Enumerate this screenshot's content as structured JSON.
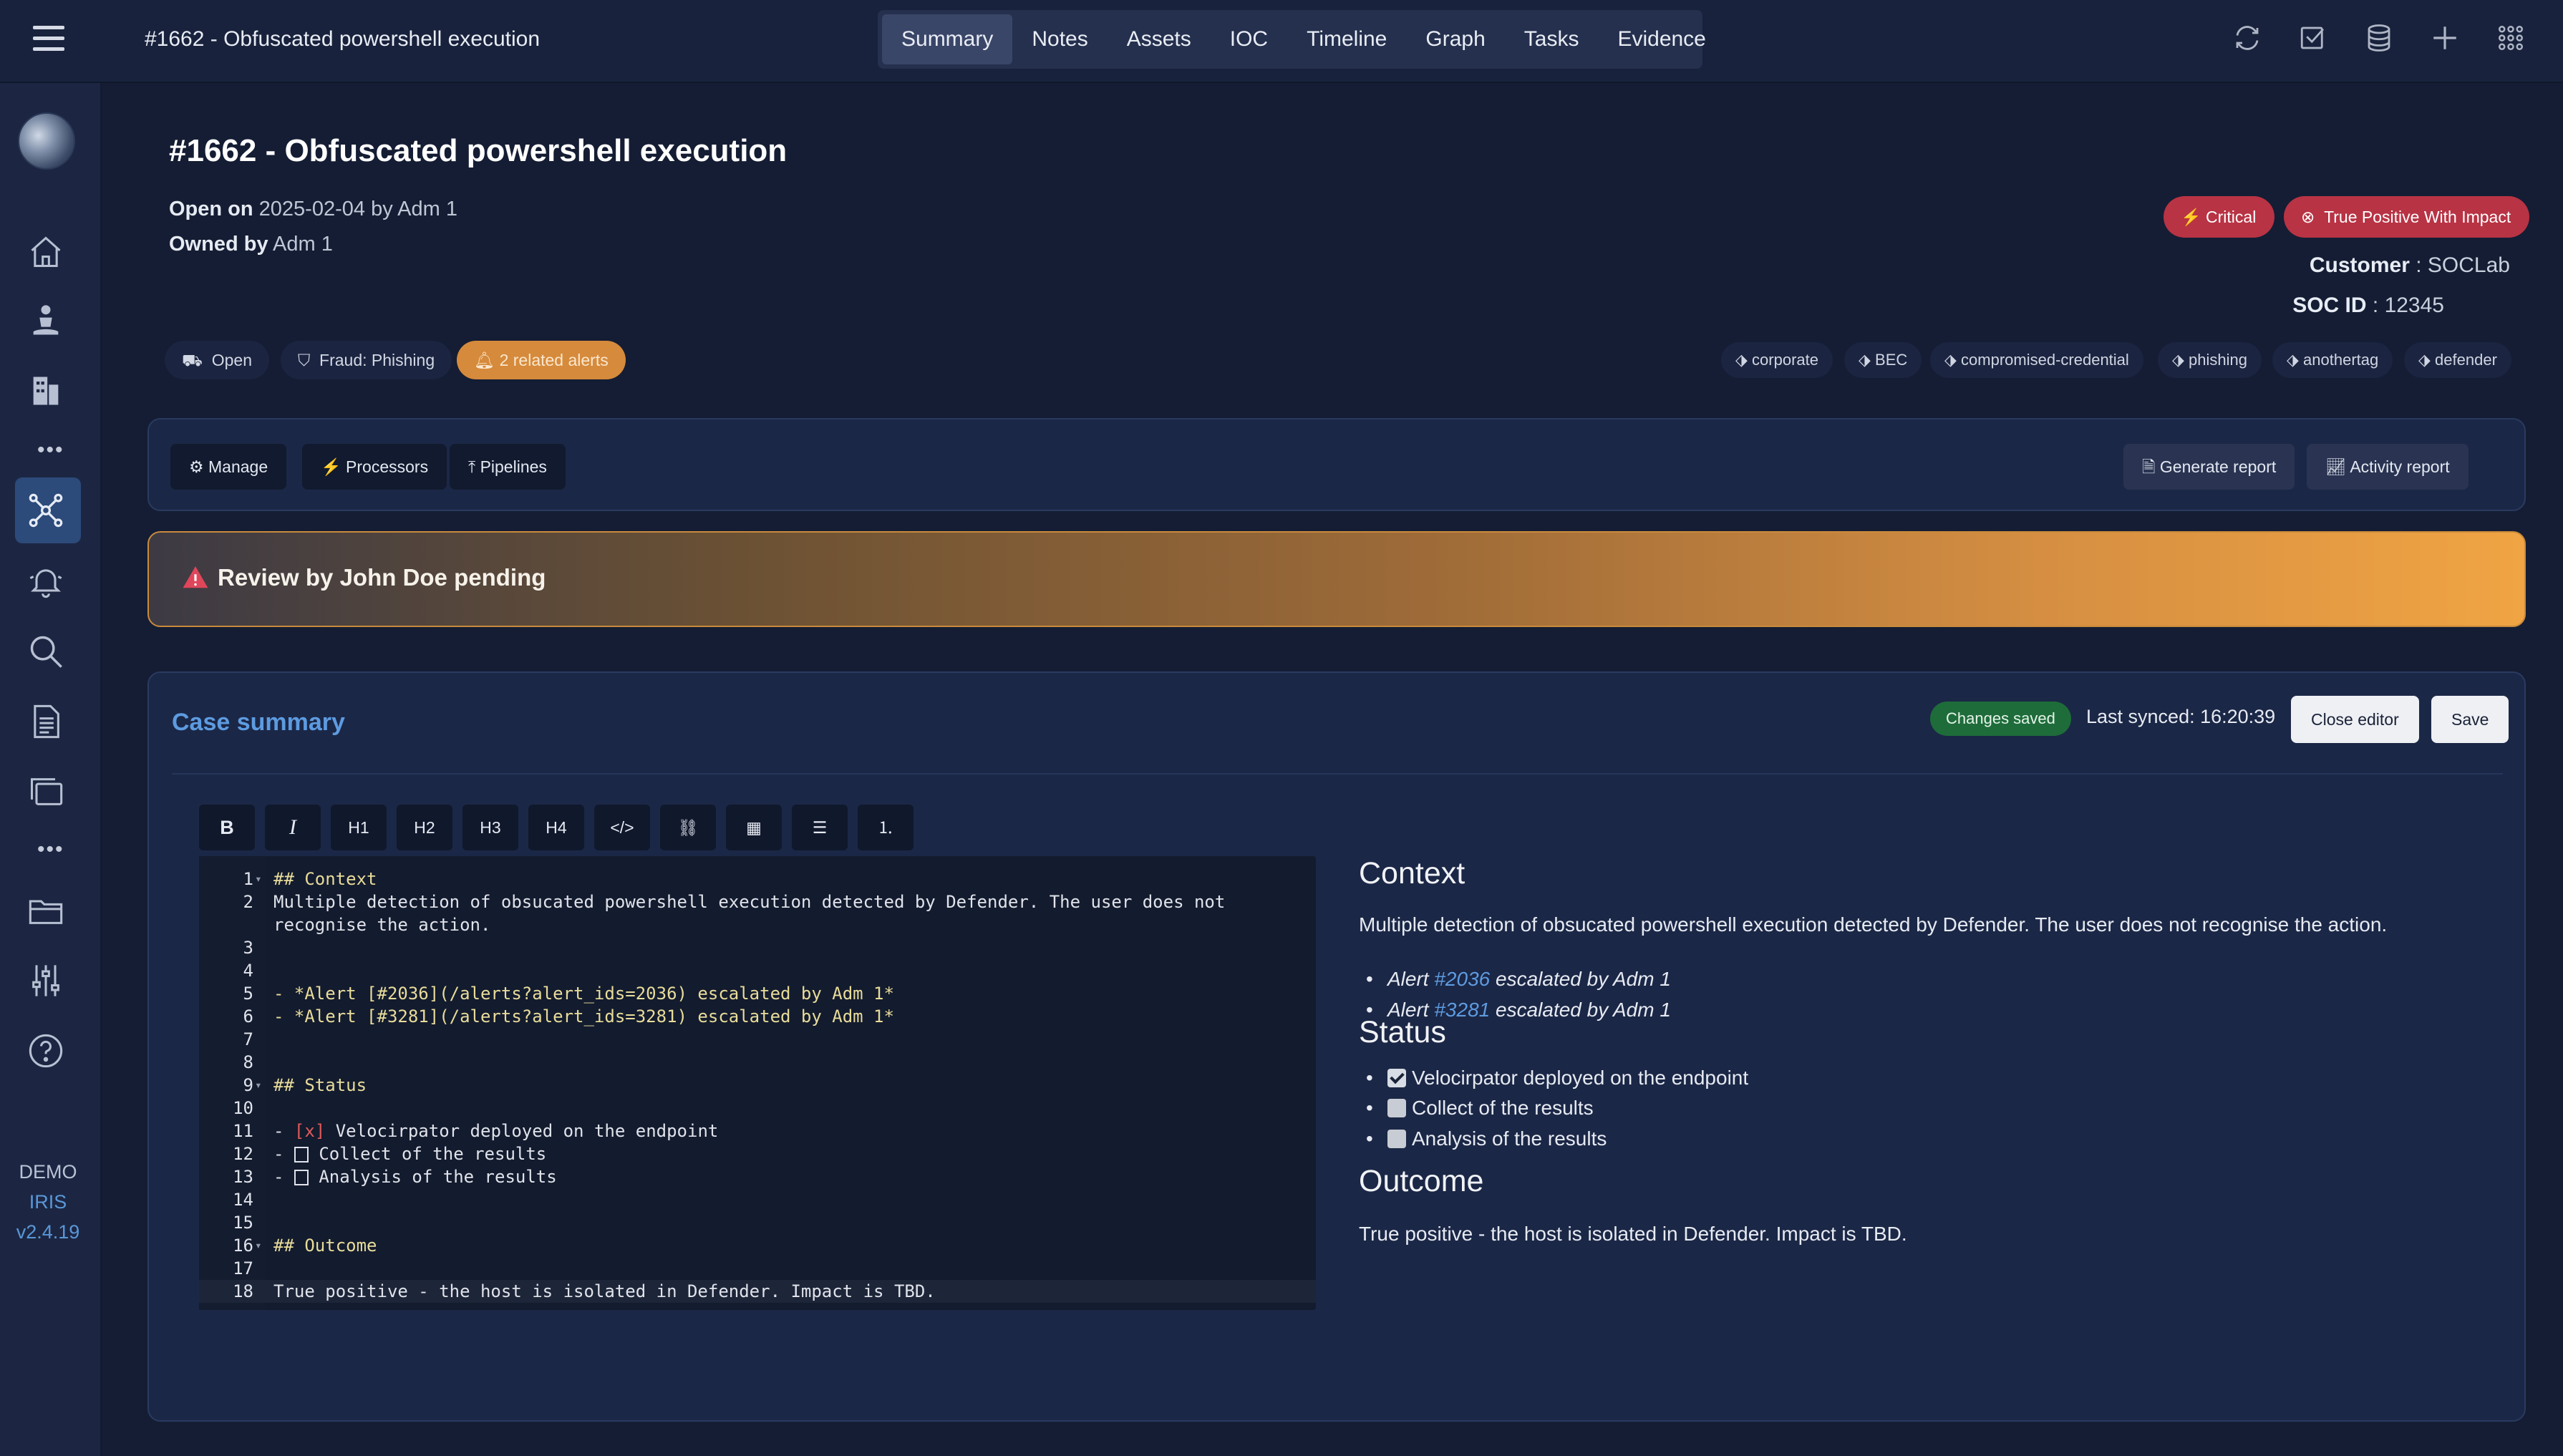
{
  "topbar": {
    "title": "#1662 - Obfuscated powershell execution",
    "tabs": [
      {
        "label": "Summary"
      },
      {
        "label": "Notes"
      },
      {
        "label": "Assets"
      },
      {
        "label": "IOC"
      },
      {
        "label": "Timeline"
      },
      {
        "label": "Graph"
      },
      {
        "label": "Tasks"
      },
      {
        "label": "Evidence"
      }
    ],
    "icons": [
      "refresh-icon",
      "check-square-icon",
      "database-icon",
      "plus-icon",
      "apps-grid-icon"
    ]
  },
  "sidebar": {
    "icons": [
      "home-icon",
      "user-icon",
      "building-icon",
      "cases-network-icon",
      "alerts-bell-icon",
      "search-icon",
      "reports-icon",
      "layers-icon",
      "folder-icon",
      "settings-sliders-icon",
      "help-icon"
    ],
    "demo_label": "DEMO",
    "iris_label": "IRIS",
    "version": "v2.4.19"
  },
  "case": {
    "title": "#1662 - Obfuscated powershell execution",
    "open_label": "Open on",
    "open_value": "2025-02-04 by Adm 1",
    "owned_label": "Owned by",
    "owned_value": "Adm 1",
    "severity": "Critical",
    "outcome": "True Positive With Impact",
    "customer_label": "Customer",
    "customer_value": "SOCLab",
    "soc_id_label": "SOC ID",
    "soc_id_value": "12345",
    "status_pill": "Open",
    "classification_pill": "Fraud: Phishing",
    "alerts_pill": "2 related alerts",
    "tags": [
      "corporate",
      "BEC",
      "compromised-credential",
      "phishing",
      "anothertag",
      "defender"
    ]
  },
  "actions": {
    "manage": "Manage",
    "processors": "Processors",
    "pipelines": "Pipelines",
    "generate_report": "Generate report",
    "activity_report": "Activity report"
  },
  "review": {
    "text": "Review by John Doe pending"
  },
  "summary": {
    "title": "Case summary",
    "saved_badge": "Changes saved",
    "last_synced": "Last synced: 16:20:39",
    "close_editor": "Close editor",
    "save": "Save",
    "toolbar": [
      "B",
      "I",
      "H1",
      "H2",
      "H3",
      "H4",
      "</>",
      "link",
      "table",
      "ul",
      "ol"
    ],
    "editor_lines": [
      {
        "n": "1",
        "text": "## Context"
      },
      {
        "n": "2",
        "text": "Multiple detection of obsucated powershell execution detected by Defender. The user does not"
      },
      {
        "n": "",
        "text": "recognise the action."
      },
      {
        "n": "3",
        "text": ""
      },
      {
        "n": "4",
        "text": ""
      },
      {
        "n": "5",
        "text": "- *Alert [#2036](/alerts?alert_ids=2036) escalated by Adm 1*"
      },
      {
        "n": "6",
        "text": "- *Alert [#3281](/alerts?alert_ids=3281) escalated by Adm 1*"
      },
      {
        "n": "7",
        "text": ""
      },
      {
        "n": "8",
        "text": ""
      },
      {
        "n": "9",
        "text": "## Status"
      },
      {
        "n": "10",
        "text": ""
      },
      {
        "n": "11",
        "text": "- [x] Velocirpator deployed on the endpoint"
      },
      {
        "n": "12",
        "text": "- [ ] Collect of the results"
      },
      {
        "n": "13",
        "text": "- [ ] Analysis of the results"
      },
      {
        "n": "14",
        "text": ""
      },
      {
        "n": "15",
        "text": ""
      },
      {
        "n": "16",
        "text": "## Outcome"
      },
      {
        "n": "17",
        "text": ""
      },
      {
        "n": "18",
        "text": "True positive - the host is isolated in Defender. Impact is TBD."
      }
    ],
    "preview": {
      "context_heading": "Context",
      "context_text": "Multiple detection of obsucated powershell execution detected by Defender. The user does not recognise the action.",
      "alert1_prefix": "Alert ",
      "alert1_link": "#2036",
      "alert1_suffix": " escalated by Adm 1",
      "alert2_prefix": "Alert ",
      "alert2_link": "#3281",
      "alert2_suffix": " escalated by Adm 1",
      "status_heading": "Status",
      "task1": "Velocirpator deployed on the endpoint",
      "task2": "Collect of the results",
      "task3": "Analysis of the results",
      "outcome_heading": "Outcome",
      "outcome_text": "True positive - the host is isolated in Defender. Impact is TBD."
    }
  }
}
